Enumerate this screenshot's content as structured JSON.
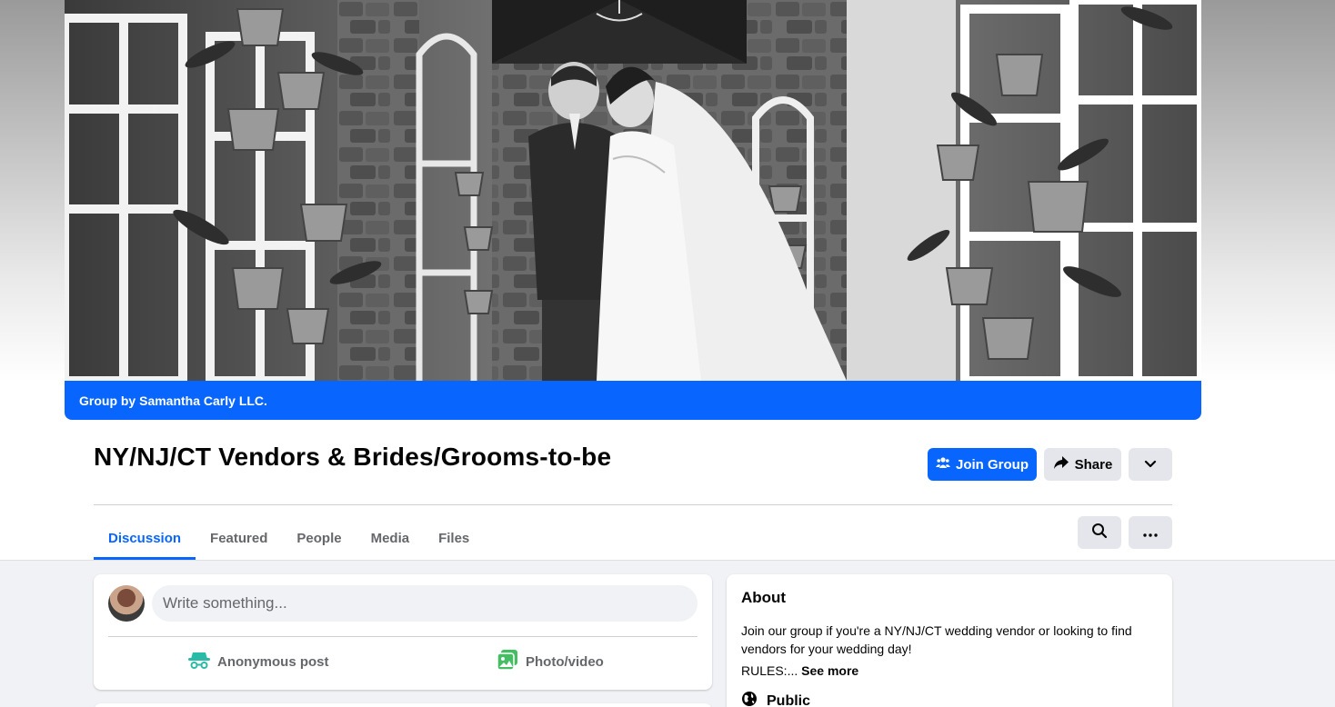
{
  "cover": {
    "banner_text": "Group by Samantha Carly LLC."
  },
  "group": {
    "title": "NY/NJ/CT Vendors & Brides/Grooms-to-be"
  },
  "actions": {
    "join_label": "Join Group",
    "share_label": "Share"
  },
  "tabs": [
    {
      "label": "Discussion",
      "active": true
    },
    {
      "label": "Featured",
      "active": false
    },
    {
      "label": "People",
      "active": false
    },
    {
      "label": "Media",
      "active": false
    },
    {
      "label": "Files",
      "active": false
    }
  ],
  "composer": {
    "placeholder": "Write something...",
    "anonymous_label": "Anonymous post",
    "photo_label": "Photo/video"
  },
  "about": {
    "title": "About",
    "description": "Join our group if you're a NY/NJ/CT wedding vendor or looking to find vendors for your wedding day!",
    "rules_prefix": "RULES:...",
    "see_more": "See more",
    "privacy": "Public"
  },
  "colors": {
    "accent": "#0866ff",
    "button_gray": "#e4e6eb",
    "page_bg": "#f0f2f5",
    "photo_icon_green": "#45bd62",
    "anon_icon_blue": "#2abba7"
  }
}
